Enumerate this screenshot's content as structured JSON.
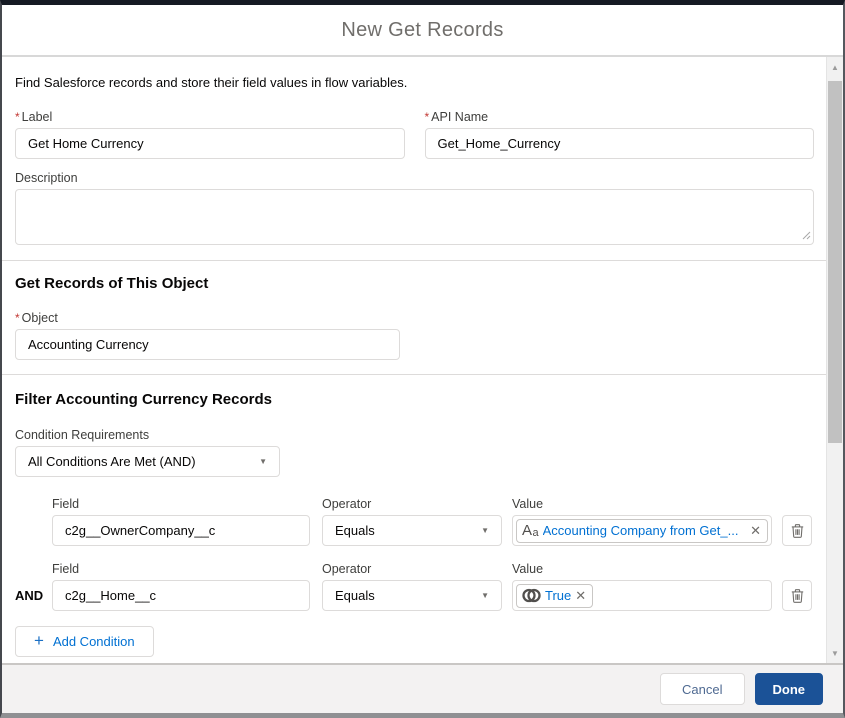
{
  "required_marker": "*",
  "title": "New Get Records",
  "intro": "Find Salesforce records and store their field values in flow variables.",
  "form": {
    "label_field": {
      "label": "Label",
      "value": "Get Home Currency"
    },
    "api_name_field": {
      "label": "API Name",
      "value": "Get_Home_Currency"
    },
    "description_field": {
      "label": "Description",
      "value": ""
    }
  },
  "object_section": {
    "heading": "Get Records of This Object",
    "object_field": {
      "label": "Object",
      "value": "Accounting Currency"
    }
  },
  "filter_section": {
    "heading": "Filter Accounting Currency Records",
    "condition_requirements_label": "Condition Requirements",
    "condition_requirements_value": "All Conditions Are Met (AND)",
    "labels": {
      "field": "Field",
      "operator": "Operator",
      "value": "Value"
    },
    "rows": [
      {
        "connector": "",
        "field": "c2g__OwnerCompany__c",
        "operator": "Equals",
        "value": "Accounting Company from Get_...",
        "value_type_icon": "text-type-icon"
      },
      {
        "connector": "AND",
        "field": "c2g__Home__c",
        "operator": "Equals",
        "value": "True",
        "value_type_icon": "boolean-type-icon"
      }
    ],
    "add_condition_label": "Add Condition"
  },
  "footer": {
    "cancel_label": "Cancel",
    "done_label": "Done"
  },
  "colors": {
    "brand_blue": "#0070d2",
    "done_button_bg": "#1b5297",
    "required_asterisk": "#c23934",
    "title_gray": "#706e6b",
    "footer_bg": "#f3f2f2",
    "scroll_thumb": "#c1c1c1"
  }
}
